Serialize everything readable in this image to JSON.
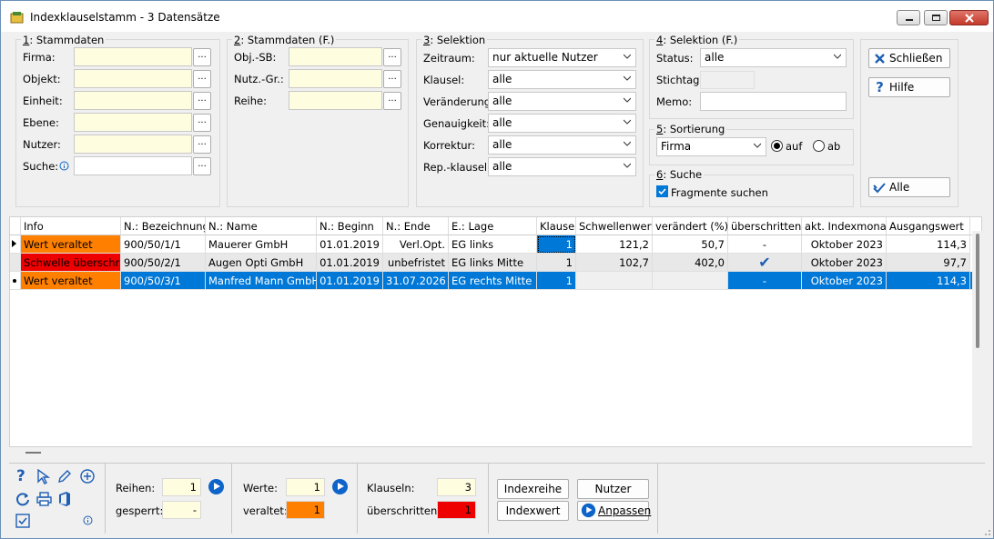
{
  "window": {
    "title": "Indexklauselstamm - 3 Datensätze"
  },
  "stamm": {
    "title_key": "1",
    "title": ": Stammdaten",
    "labels": [
      "Firma:",
      "Objekt:",
      "Einheit:",
      "Ebene:",
      "Nutzer:",
      "Suche:"
    ],
    "dots": "..."
  },
  "stammf": {
    "title_key": "2",
    "title": ": Stammdaten (F.)",
    "labels": [
      "Obj.-SB:",
      "Nutz.-Gr.:",
      "Reihe:"
    ]
  },
  "selektion": {
    "title_key": "3",
    "title": ": Selektion",
    "rows": [
      {
        "label": "Zeitraum:",
        "value": "nur aktuelle Nutzer"
      },
      {
        "label": "Klausel:",
        "value": "alle"
      },
      {
        "label": "Veränderung:",
        "value": "alle"
      },
      {
        "label": "Genauigkeit:",
        "value": "alle"
      },
      {
        "label": "Korrektur:",
        "value": "alle"
      },
      {
        "label": "Rep.-klausel:",
        "value": "alle"
      }
    ]
  },
  "selektionf": {
    "title_key": "4",
    "title": ": Selektion (F.)",
    "status_label": "Status:",
    "status_value": "alle",
    "stichtag_label": "Stichtag:",
    "memo_label": "Memo:"
  },
  "sortierung": {
    "title_key": "5",
    "title": ": Sortierung",
    "value": "Firma",
    "auf": "auf",
    "ab": "ab"
  },
  "suche": {
    "title_key": "6",
    "title": ": Suche",
    "fragmente": "Fragmente suchen"
  },
  "buttons": {
    "schliessen": "Schließen",
    "hilfe": "Hilfe",
    "alle": "Alle"
  },
  "table": {
    "headers": [
      "Info",
      "N.: Bezeichnung",
      "N.: Name",
      "N.: Beginn",
      "N.: Ende",
      "E.: Lage",
      "Klausel",
      "Schwellenwert",
      "verändert (%)",
      "überschritten",
      "akt. Indexmonat",
      "Ausgangswert"
    ],
    "rows": [
      {
        "info": "Wert veraltet",
        "bez": "900/50/1/1",
        "name": "Mauerer GmbH",
        "beginn": "01.01.2019",
        "ende": "Verl.Opt.",
        "lage": "EG links",
        "klausel": "1",
        "schwelle": "121,2",
        "veraendert": "50,7",
        "ueber": "-",
        "monat": "Oktober 2023",
        "ausgang": "114,3"
      },
      {
        "info": "Schwelle überschritten",
        "bez": "900/50/2/1",
        "name": "Augen Opti GmbH",
        "beginn": "01.01.2019",
        "ende": "unbefristet",
        "lage": "EG links Mitte",
        "klausel": "1",
        "schwelle": "102,7",
        "veraendert": "402,0",
        "ueber": "✔",
        "monat": "Oktober 2023",
        "ausgang": "97,7"
      },
      {
        "info": "Wert veraltet",
        "bez": "900/50/3/1",
        "name": "Manfred Mann GmbH",
        "beginn": "01.01.2019",
        "ende": "31.07.2026",
        "lage": "EG rechts Mitte",
        "klausel": "1",
        "schwelle": "",
        "veraendert": "",
        "ueber": "-",
        "monat": "Oktober 2023",
        "ausgang": "114,3"
      }
    ]
  },
  "footer": {
    "reihen_label": "Reihen:",
    "reihen": "1",
    "gesperrt_label": "gesperrt:",
    "gesperrt": "-",
    "werte_label": "Werte:",
    "werte": "1",
    "veraltet_label": "veraltet:",
    "veraltet": "1",
    "klauseln_label": "Klauseln:",
    "klauseln": "3",
    "ueberschritten_label": "überschritten:",
    "ueberschritten": "1",
    "indexreihe": "Indexreihe",
    "nutzer": "Nutzer",
    "indexwert": "Indexwert",
    "anpassen": "Anpassen"
  },
  "colors": {
    "orange": "#ff8000",
    "red": "#ee0000",
    "selected": "#0078d7",
    "yellow": "#fffde0"
  }
}
